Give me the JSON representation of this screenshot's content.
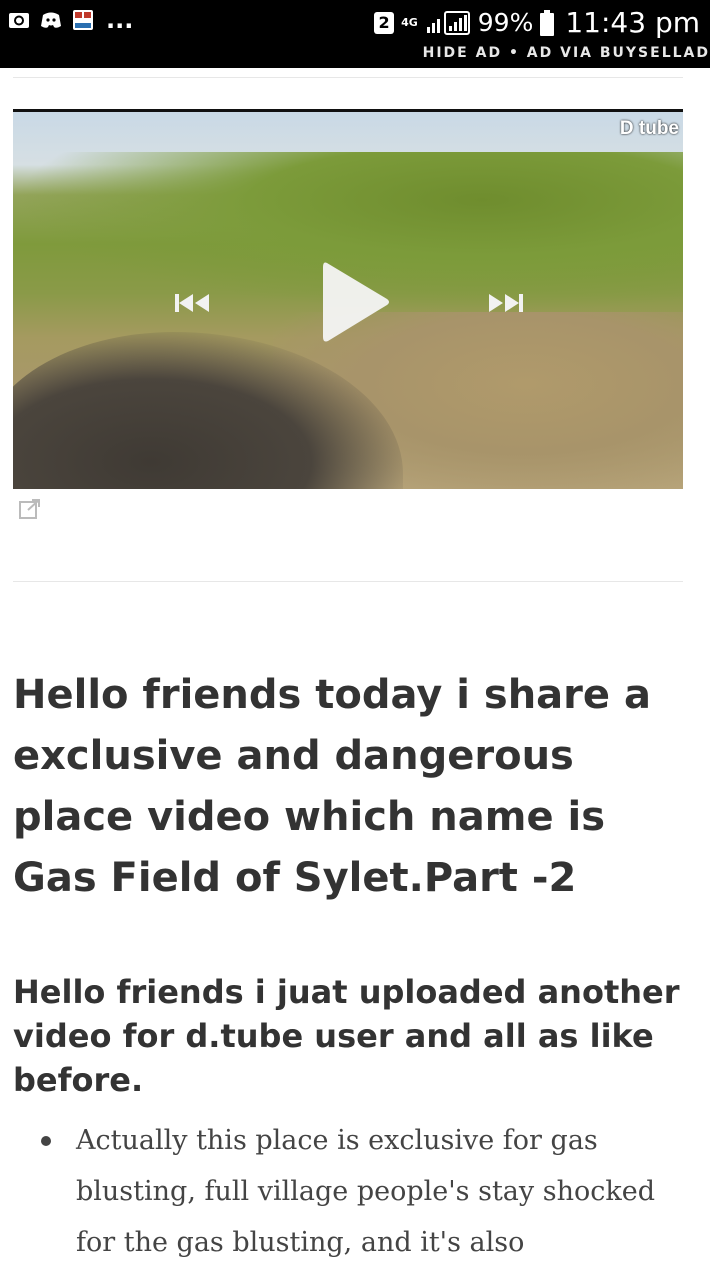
{
  "status_bar": {
    "sim_badge": "2",
    "network": "4G",
    "battery": "99%",
    "time": "11:43 pm",
    "overflow": "..."
  },
  "ad_bar": {
    "hide_ad": "HIDE AD",
    "separator": "•",
    "ad_via": "AD VIA BUYSELLAD"
  },
  "video": {
    "logo": "D tube"
  },
  "article": {
    "title": "Hello friends today i share a exclusive and dangerous place video which name is Gas Field of Sylet.Part -2",
    "subtitle": "Hello friends i juat uploaded another video for d.tube user and all as like before.",
    "bullets": [
      "Actually this place is exclusive for gas blusting, full village people's stay shocked for the gas blusting, and it's also"
    ]
  },
  "colors": {
    "status_bg": "#000000",
    "text_primary": "#333333",
    "divider": "#e7e7e7"
  },
  "icons": {
    "camera": "camera-icon",
    "discord": "discord-icon",
    "news": "news-app-icon",
    "play": "play-icon",
    "prev": "skip-previous-icon",
    "next": "skip-next-icon",
    "external": "external-link-icon"
  }
}
